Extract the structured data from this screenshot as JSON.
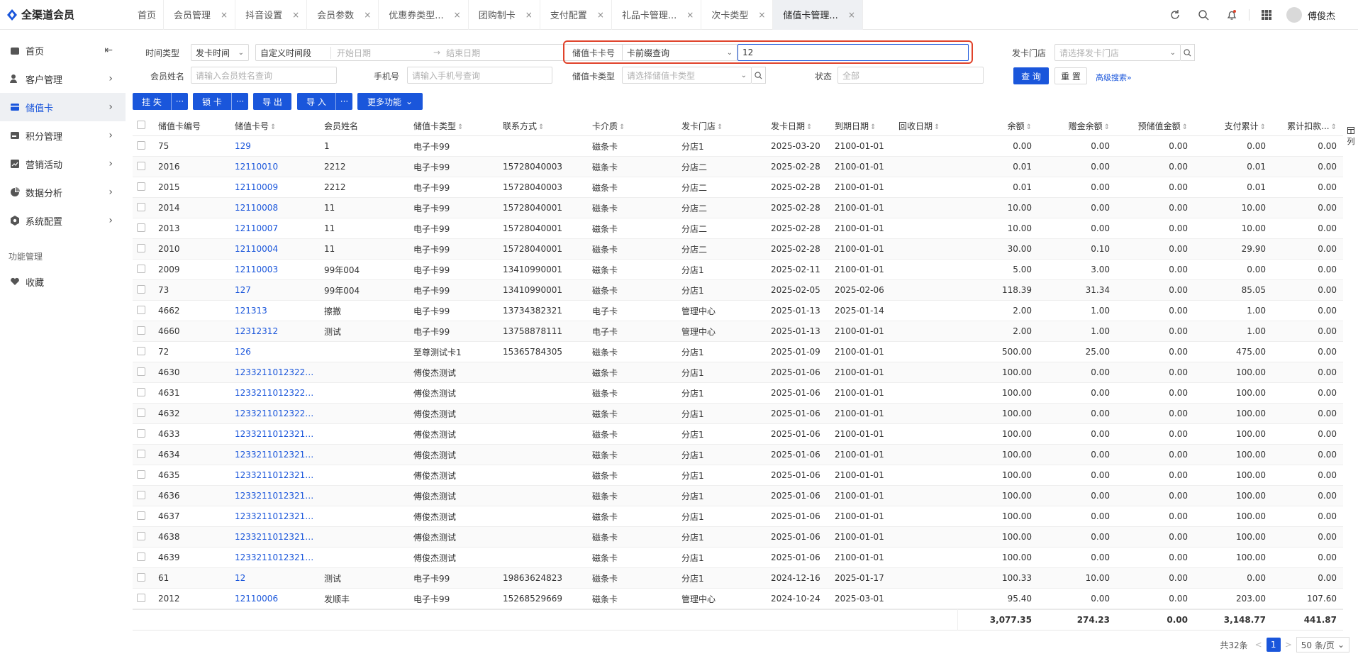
{
  "app": {
    "brand": "全渠道会员"
  },
  "tabs": [
    {
      "label": "首页"
    },
    {
      "label": "会员管理"
    },
    {
      "label": "抖音设置"
    },
    {
      "label": "会员参数"
    },
    {
      "label": "优惠券类型..."
    },
    {
      "label": "团购制卡"
    },
    {
      "label": "支付配置"
    },
    {
      "label": "礼品卡管理..."
    },
    {
      "label": "次卡类型"
    },
    {
      "label": "储值卡管理..."
    }
  ],
  "tab_close": "×",
  "user": {
    "name": "傅俊杰"
  },
  "sidebar": {
    "items": [
      {
        "label": "首页"
      },
      {
        "label": "客户管理"
      },
      {
        "label": "储值卡"
      },
      {
        "label": "积分管理"
      },
      {
        "label": "营销活动"
      },
      {
        "label": "数据分析"
      },
      {
        "label": "系统配置"
      }
    ],
    "section": "功能管理",
    "fav": "收藏"
  },
  "filters": {
    "time_type_label": "时间类型",
    "time_type_value": "发卡时间",
    "time_range_value": "自定义时间段",
    "start_placeholder": "开始日期",
    "range_arrow": "→",
    "end_placeholder": "结束日期",
    "card_no_label": "储值卡卡号",
    "card_query_mode": "卡前缀查询",
    "card_no_value": "12",
    "store_label": "发卡门店",
    "store_placeholder": "请选择发卡门店",
    "member_name_label": "会员姓名",
    "member_name_placeholder": "请输入会员姓名查询",
    "phone_label": "手机号",
    "phone_placeholder": "请输入手机号查询",
    "card_type_label": "储值卡类型",
    "card_type_placeholder": "请选择储值卡类型",
    "status_label": "状态",
    "status_value": "全部",
    "query_btn": "查 询",
    "reset_btn": "重 置",
    "advanced": "高级搜索»"
  },
  "toolbar": {
    "loss": "挂 失",
    "lock": "锁 卡",
    "export": "导 出",
    "import": "导 入",
    "more": "更多功能",
    "more_dots": "···"
  },
  "table": {
    "columns": [
      "储值卡编号",
      "储值卡号",
      "会员姓名",
      "储值卡类型",
      "联系方式",
      "卡介质",
      "发卡门店",
      "发卡日期",
      "到期日期",
      "回收日期",
      "余额",
      "赠金余额",
      "预储值金额",
      "支付累计",
      "累计扣款..."
    ],
    "rows": [
      [
        "75",
        "129",
        "1",
        "电子卡99",
        "",
        "磁条卡",
        "分店1",
        "2025-03-20",
        "2100-01-01",
        "",
        "0.00",
        "0.00",
        "0.00",
        "0.00",
        "0.00"
      ],
      [
        "2016",
        "12110010",
        "2212",
        "电子卡99",
        "15728040003",
        "磁条卡",
        "分店二",
        "2025-02-28",
        "2100-01-01",
        "",
        "0.01",
        "0.00",
        "0.00",
        "0.01",
        "0.00"
      ],
      [
        "2015",
        "12110009",
        "2212",
        "电子卡99",
        "15728040003",
        "磁条卡",
        "分店二",
        "2025-02-28",
        "2100-01-01",
        "",
        "0.01",
        "0.00",
        "0.00",
        "0.01",
        "0.00"
      ],
      [
        "2014",
        "12110008",
        "11",
        "电子卡99",
        "15728040001",
        "磁条卡",
        "分店二",
        "2025-02-28",
        "2100-01-01",
        "",
        "10.00",
        "0.00",
        "0.00",
        "10.00",
        "0.00"
      ],
      [
        "2013",
        "12110007",
        "11",
        "电子卡99",
        "15728040001",
        "磁条卡",
        "分店二",
        "2025-02-28",
        "2100-01-01",
        "",
        "10.00",
        "0.00",
        "0.00",
        "10.00",
        "0.00"
      ],
      [
        "2010",
        "12110004",
        "11",
        "电子卡99",
        "15728040001",
        "磁条卡",
        "分店二",
        "2025-02-28",
        "2100-01-01",
        "",
        "30.00",
        "0.10",
        "0.00",
        "29.90",
        "0.00"
      ],
      [
        "2009",
        "12110003",
        "99年004",
        "电子卡99",
        "13410990001",
        "磁条卡",
        "分店1",
        "2025-02-11",
        "2100-01-01",
        "",
        "5.00",
        "3.00",
        "0.00",
        "0.00",
        "0.00"
      ],
      [
        "73",
        "127",
        "99年004",
        "电子卡99",
        "13410990001",
        "磁条卡",
        "分店1",
        "2025-02-05",
        "2025-02-06",
        "",
        "118.39",
        "31.34",
        "0.00",
        "85.05",
        "0.00"
      ],
      [
        "4662",
        "121313",
        "擦撤",
        "电子卡99",
        "13734382321",
        "电子卡",
        "管理中心",
        "2025-01-13",
        "2025-01-14",
        "",
        "2.00",
        "1.00",
        "0.00",
        "1.00",
        "0.00"
      ],
      [
        "4660",
        "12312312",
        "测试",
        "电子卡99",
        "13758878111",
        "电子卡",
        "管理中心",
        "2025-01-13",
        "2100-01-01",
        "",
        "2.00",
        "1.00",
        "0.00",
        "1.00",
        "0.00"
      ],
      [
        "72",
        "126",
        "",
        "至尊测试卡1",
        "15365784305",
        "磁条卡",
        "分店1",
        "2025-01-09",
        "2100-01-01",
        "",
        "500.00",
        "25.00",
        "0.00",
        "475.00",
        "0.00"
      ],
      [
        "4630",
        "12332110123222...",
        "",
        "傅俊杰测试",
        "",
        "磁条卡",
        "分店1",
        "2025-01-06",
        "2100-01-01",
        "",
        "100.00",
        "0.00",
        "0.00",
        "100.00",
        "0.00"
      ],
      [
        "4631",
        "12332110123221...",
        "",
        "傅俊杰测试",
        "",
        "磁条卡",
        "分店1",
        "2025-01-06",
        "2100-01-01",
        "",
        "100.00",
        "0.00",
        "0.00",
        "100.00",
        "0.00"
      ],
      [
        "4632",
        "12332110123220...",
        "",
        "傅俊杰测试",
        "",
        "磁条卡",
        "分店1",
        "2025-01-06",
        "2100-01-01",
        "",
        "100.00",
        "0.00",
        "0.00",
        "100.00",
        "0.00"
      ],
      [
        "4633",
        "12332110123219...",
        "",
        "傅俊杰测试",
        "",
        "磁条卡",
        "分店1",
        "2025-01-06",
        "2100-01-01",
        "",
        "100.00",
        "0.00",
        "0.00",
        "100.00",
        "0.00"
      ],
      [
        "4634",
        "12332110123218...",
        "",
        "傅俊杰测试",
        "",
        "磁条卡",
        "分店1",
        "2025-01-06",
        "2100-01-01",
        "",
        "100.00",
        "0.00",
        "0.00",
        "100.00",
        "0.00"
      ],
      [
        "4635",
        "12332110123217...",
        "",
        "傅俊杰测试",
        "",
        "磁条卡",
        "分店1",
        "2025-01-06",
        "2100-01-01",
        "",
        "100.00",
        "0.00",
        "0.00",
        "100.00",
        "0.00"
      ],
      [
        "4636",
        "12332110123216...",
        "",
        "傅俊杰测试",
        "",
        "磁条卡",
        "分店1",
        "2025-01-06",
        "2100-01-01",
        "",
        "100.00",
        "0.00",
        "0.00",
        "100.00",
        "0.00"
      ],
      [
        "4637",
        "12332110123215...",
        "",
        "傅俊杰测试",
        "",
        "磁条卡",
        "分店1",
        "2025-01-06",
        "2100-01-01",
        "",
        "100.00",
        "0.00",
        "0.00",
        "100.00",
        "0.00"
      ],
      [
        "4638",
        "12332110123214...",
        "",
        "傅俊杰测试",
        "",
        "磁条卡",
        "分店1",
        "2025-01-06",
        "2100-01-01",
        "",
        "100.00",
        "0.00",
        "0.00",
        "100.00",
        "0.00"
      ],
      [
        "4639",
        "12332110123213...",
        "",
        "傅俊杰测试",
        "",
        "磁条卡",
        "分店1",
        "2025-01-06",
        "2100-01-01",
        "",
        "100.00",
        "0.00",
        "0.00",
        "100.00",
        "0.00"
      ],
      [
        "61",
        "12",
        "测试",
        "电子卡99",
        "19863624823",
        "磁条卡",
        "分店1",
        "2024-12-16",
        "2025-01-17",
        "",
        "100.33",
        "10.00",
        "0.00",
        "0.00",
        "0.00"
      ],
      [
        "2012",
        "12110006",
        "发顺丰",
        "电子卡99",
        "15268529669",
        "磁条卡",
        "管理中心",
        "2024-10-24",
        "2025-03-01",
        "",
        "95.40",
        "0.00",
        "0.00",
        "203.00",
        "107.60"
      ]
    ],
    "totals": {
      "balance": "3,077.35",
      "gift": "274.23",
      "prestore": "0.00",
      "paid": "3,148.77",
      "deducted": "441.87"
    },
    "col_setting": "列"
  },
  "pagination": {
    "total": "共32条",
    "prev": "<",
    "page": "1",
    "next": ">",
    "page_size": "50 条/页"
  },
  "colors": {
    "accent": "#1a56db",
    "highlight": "#e0432b"
  }
}
